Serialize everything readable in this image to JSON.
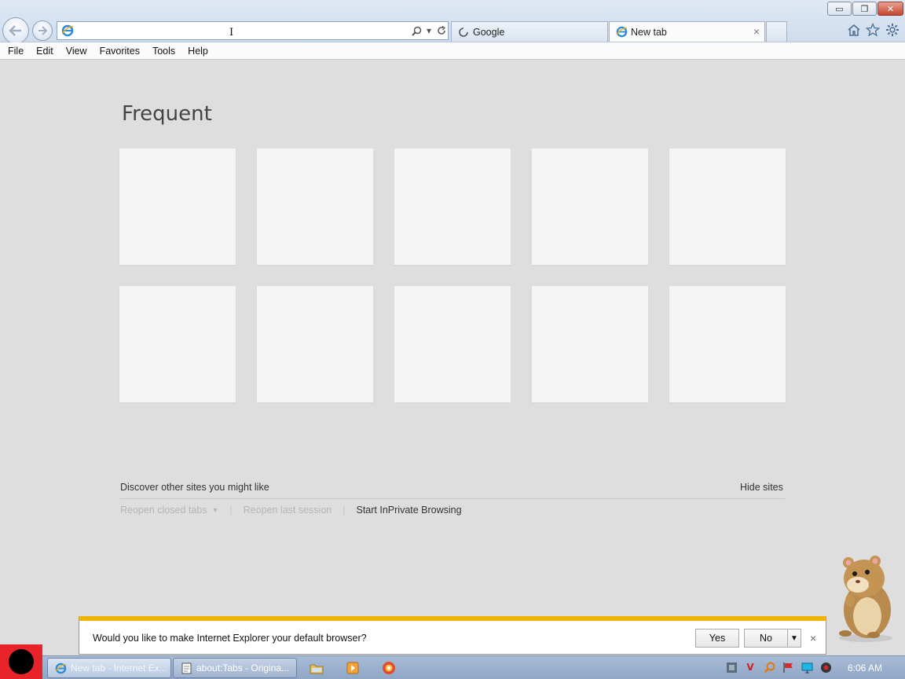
{
  "window": {
    "minimize_label": "▭",
    "maximize_label": "❐",
    "close_label": "✕"
  },
  "address_bar": {
    "value": "",
    "placeholder": ""
  },
  "tabs": [
    {
      "label": "Google",
      "icon": "loading-icon"
    },
    {
      "label": "New tab",
      "icon": "ie-icon",
      "close": "×"
    },
    {
      "label": "",
      "icon": "new-tab"
    }
  ],
  "toolbar_icons": [
    "home-icon",
    "star-icon",
    "gear-icon"
  ],
  "menu": {
    "items": [
      "File",
      "Edit",
      "View",
      "Favorites",
      "Tools",
      "Help"
    ]
  },
  "content": {
    "title": "Frequent",
    "tiles_count": 10,
    "discover": "Discover other sites you might like",
    "hide_sites": "Hide sites",
    "reopen_closed_tabs": "Reopen closed tabs",
    "reopen_last_session": "Reopen last session",
    "start_inprivate": "Start InPrivate Browsing"
  },
  "notification": {
    "message": "Would you like to make Internet Explorer your default browser?",
    "yes": "Yes",
    "no": "No",
    "close": "×"
  },
  "taskbar": {
    "buttons": [
      {
        "label": "New tab - Internet Ex...",
        "icon": "ie-icon"
      },
      {
        "label": "about:Tabs - Origina...",
        "icon": "page-icon"
      }
    ],
    "pinned": [
      "explorer-folder-icon",
      "media-player-icon",
      "app-icon"
    ],
    "clock": "6:06 AM"
  },
  "colors": {
    "notification_accent": "#f0b400",
    "start_button": "#e8232a",
    "content_bg": "#dedede"
  }
}
